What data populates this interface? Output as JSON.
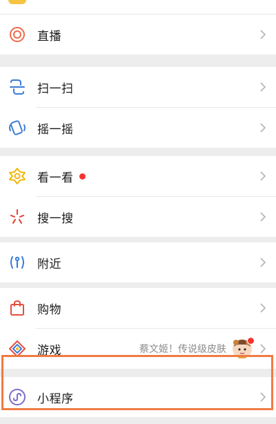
{
  "colors": {
    "page_background": "#ededed",
    "row_background": "#ffffff",
    "label_text": "#1a1a1a",
    "subtext": "#8a8a8a",
    "red_dot": "#f43530",
    "chevron": "#b2b2b2",
    "highlight_border": "#f07a43"
  },
  "menu": {
    "live": {
      "label": "直播",
      "icon": "live-ring-icon"
    },
    "scan": {
      "label": "扫一扫",
      "icon": "scan-icon"
    },
    "shake": {
      "label": "摇一摇",
      "icon": "shake-icon"
    },
    "top_stories": {
      "label": "看一看",
      "icon": "top-stories-icon",
      "has_red_dot": true
    },
    "search": {
      "label": "搜一搜",
      "icon": "search-star-icon"
    },
    "nearby": {
      "label": "附近",
      "icon": "nearby-icon"
    },
    "shopping": {
      "label": "购物",
      "icon": "shopping-bag-icon"
    },
    "games": {
      "label": "游戏",
      "icon": "games-icon",
      "subtitle": "蔡文姬！传说级皮肤",
      "has_avatar_badge": true
    },
    "mini_programs": {
      "label": "小程序",
      "icon": "mini-program-icon",
      "highlighted": true
    }
  }
}
